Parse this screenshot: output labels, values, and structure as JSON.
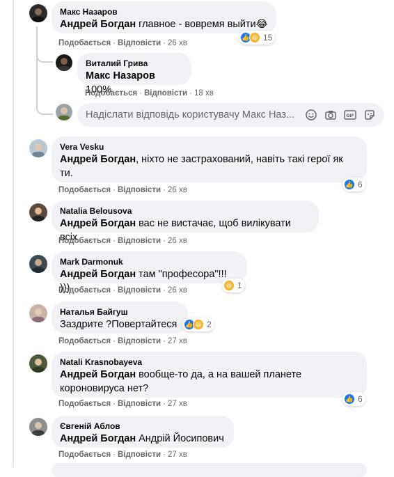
{
  "reply_input": {
    "placeholder": "Надіслати відповідь користувачу Макс Наз..."
  },
  "colors": {
    "like": "#1877f2",
    "haha": "#f7b125",
    "secondary_text": "#65676b",
    "bubble": "#f0f2f5"
  },
  "comments": [
    {
      "author": "Макс Назаров",
      "tag": "Андрей Богдан",
      "text": " главное - вовремя выйти😂",
      "like": "Подобається",
      "reply": "Відповісти",
      "time": "26 хв",
      "reactions": "15"
    },
    {
      "author": "Виталий Грива",
      "tag": "Макс Назаров",
      "text": " 100%",
      "like": "Подобається",
      "reply": "Відповісти",
      "time": "18 хв"
    },
    {
      "author": "Vera Vesku",
      "tag": "Андрей Богдан",
      "text": ", ніхто не застрахований, навіть такі герої як",
      "text2": "ти.",
      "like": "Подобається",
      "reply": "Відповісти",
      "time": "26 хв",
      "reactions": "6"
    },
    {
      "author": "Natalia Belousova",
      "tag": "Андрей Богдан",
      "text": " вас не вистачає, щоб вилікувати всіх",
      "like": "Подобається",
      "reply": "Відповісти",
      "time": "26 хв"
    },
    {
      "author": "Mark Darmonuk",
      "tag": "Андрей Богдан",
      "text": " там \"професора\"!!! )))",
      "like": "Подобається",
      "reply": "Відповісти",
      "time": "26 хв",
      "reactions": "1"
    },
    {
      "author": "Наталья Байгуш",
      "text": "Заздрите ?Повертайтеся .",
      "like": "Подобається",
      "reply": "Відповісти",
      "time": "27 хв",
      "reactions": "2"
    },
    {
      "author": "Natali Krasnobayeva",
      "tag": "Андрей Богдан",
      "text": " вообще-то да, а на вашей планете",
      "text2": "короновируса нет?",
      "like": "Подобається",
      "reply": "Відповісти",
      "time": "27 хв",
      "reactions": "6"
    },
    {
      "author": "Євгеній Аблов",
      "tag": "Андрей Богдан",
      "text": " Андрій Йосипович",
      "like": "Подобається",
      "reply": "Відповісти",
      "time": "27 хв"
    }
  ]
}
